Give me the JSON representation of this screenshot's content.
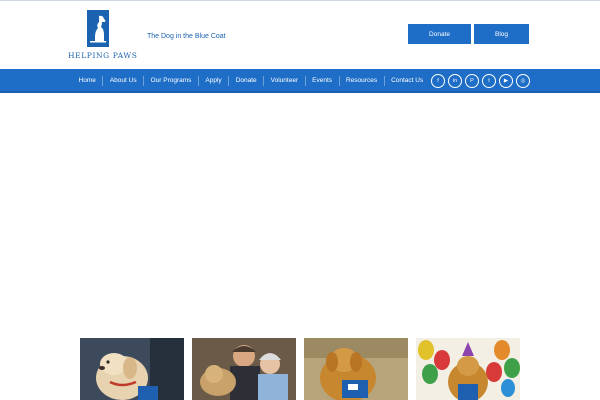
{
  "header": {
    "logo_text": "HELPING PAWS",
    "tagline": "The Dog in the Blue Coat",
    "buttons": {
      "donate": "Donate",
      "blog": "Blog"
    }
  },
  "nav": {
    "items": [
      "Home",
      "About Us",
      "Our Programs",
      "Apply",
      "Donate",
      "Volunteer",
      "Events",
      "Resources",
      "Contact Us"
    ]
  },
  "social": {
    "icons": [
      {
        "name": "facebook-icon",
        "glyph": "f"
      },
      {
        "name": "linkedin-icon",
        "glyph": "in"
      },
      {
        "name": "pinterest-icon",
        "glyph": "P"
      },
      {
        "name": "twitter-icon",
        "glyph": "t"
      },
      {
        "name": "youtube-icon",
        "glyph": "▶"
      },
      {
        "name": "instagram-icon",
        "glyph": "◎"
      }
    ]
  },
  "colors": {
    "brand_blue": "#1e6ec7",
    "logo_blue": "#1b63b0"
  },
  "tiles": [
    {
      "name": "tile-puppy"
    },
    {
      "name": "tile-people-with-puppy"
    },
    {
      "name": "tile-golden-in-vest"
    },
    {
      "name": "tile-birthday-dog"
    }
  ]
}
